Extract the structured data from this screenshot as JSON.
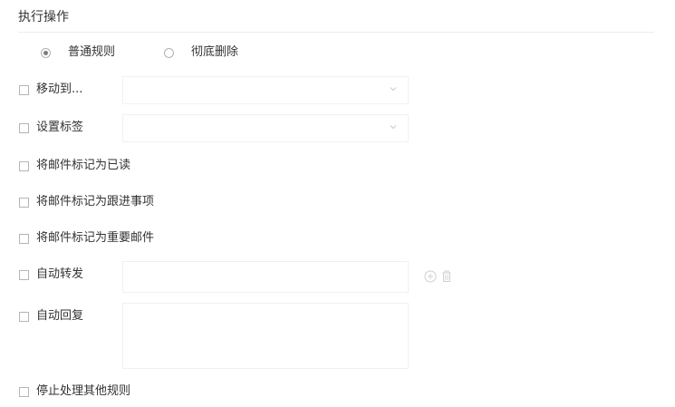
{
  "section": {
    "title": "执行操作"
  },
  "mode": {
    "options": [
      {
        "label": "普通规则",
        "selected": true
      },
      {
        "label": "彻底删除",
        "selected": false
      }
    ]
  },
  "actions": {
    "move_to": {
      "label": "移动到...",
      "checked": false,
      "select_value": ""
    },
    "set_tag": {
      "label": "设置标签",
      "checked": false,
      "select_value": ""
    },
    "mark_read": {
      "label": "将邮件标记为已读",
      "checked": false
    },
    "mark_followup": {
      "label": "将邮件标记为跟进事项",
      "checked": false
    },
    "mark_important": {
      "label": "将邮件标记为重要邮件",
      "checked": false
    },
    "auto_forward": {
      "label": "自动转发",
      "checked": false,
      "input_value": ""
    },
    "auto_reply": {
      "label": "自动回复",
      "checked": false,
      "textarea_value": ""
    },
    "stop_processing": {
      "label": "停止处理其他规则",
      "checked": false
    }
  },
  "icons": {
    "chevron": "chevron-down-icon",
    "add": "add-circle-icon",
    "delete": "trash-icon"
  },
  "colors": {
    "text": "#333333",
    "border": "#f0f0f0",
    "divider": "#ececec",
    "icon": "#c8c8c8"
  }
}
